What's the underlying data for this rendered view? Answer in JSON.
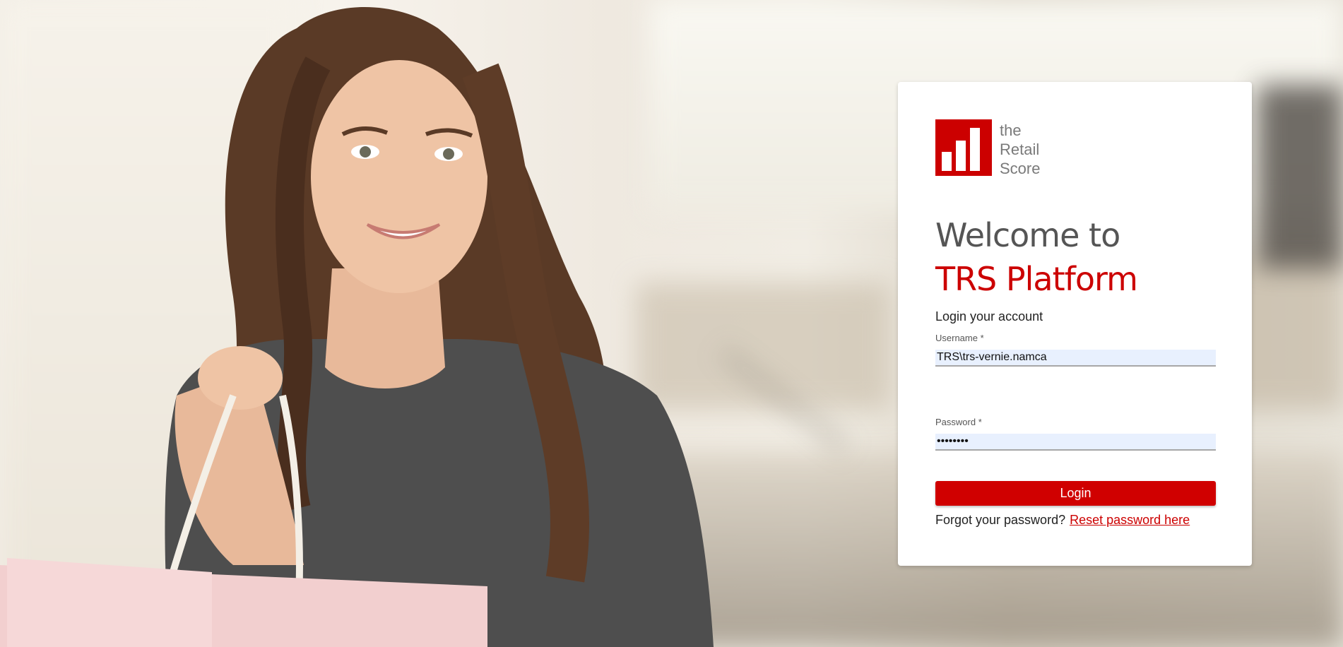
{
  "brand": {
    "logo_icon": "bar-chart-logo-icon",
    "logo_text": [
      "the",
      "Retail",
      "Score"
    ],
    "accent_color": "#cc0000"
  },
  "heading": {
    "line1": "Welcome to",
    "line2": "TRS Platform"
  },
  "subtitle": "Login your account",
  "form": {
    "username_label": "Username *",
    "username_value": "TRS\\trs-vernie.namca",
    "password_label": "Password *",
    "password_value": "password",
    "login_label": "Login"
  },
  "forgot": {
    "text": "Forgot your password?",
    "link_label": "Reset password here"
  }
}
